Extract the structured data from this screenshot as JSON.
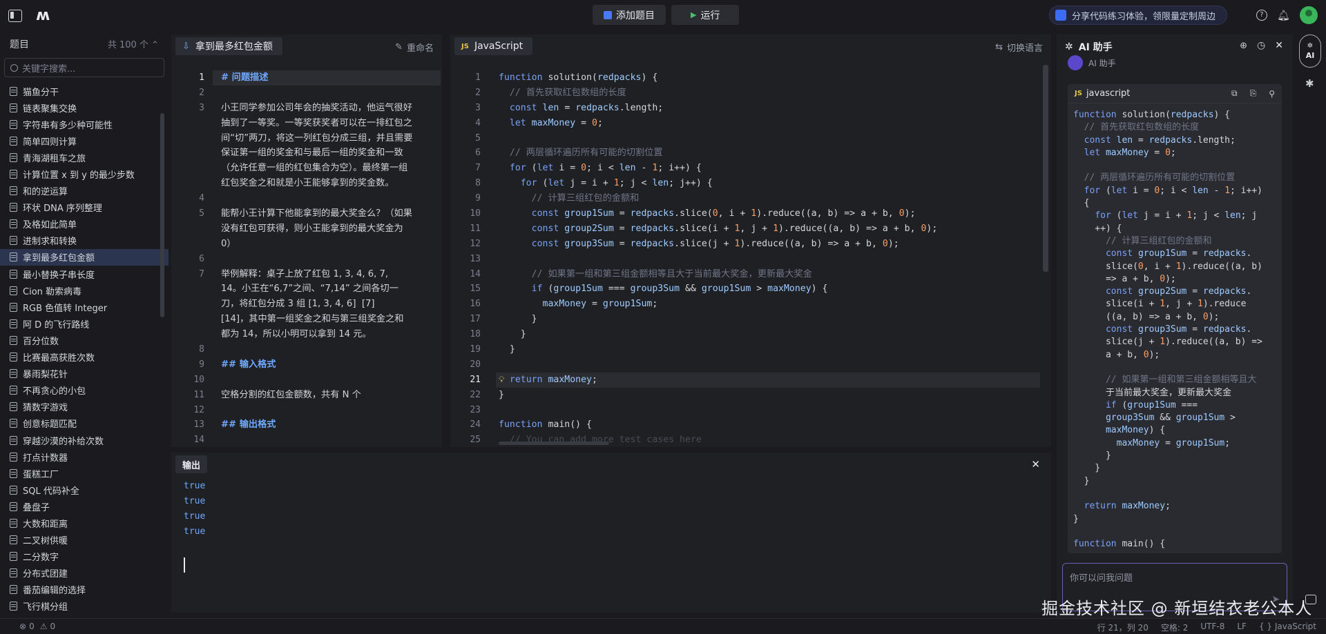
{
  "topbar": {
    "add_problem": "添加题目",
    "run": "运行",
    "promo": "分享代码练习体验，领限量定制周边"
  },
  "problems": {
    "title": "题目",
    "count": "共 100 个",
    "search_placeholder": "关键字搜索...",
    "items": [
      "猫鱼分干",
      "链表聚集交换",
      "字符串有多少种可能性",
      "简单四则计算",
      "青海湖租车之旅",
      "计算位置 x 到 y 的最少步数",
      "和的逆运算",
      "环状 DNA 序列整理",
      "及格如此简单",
      "进制求和转换",
      "拿到最多红包金额",
      "最小替换子串长度",
      "Cion 勒索病毒",
      "RGB 色值转 Integer",
      "阿 D 的飞行路线",
      "百分位数",
      "比赛最高获胜次数",
      "暴雨梨花针",
      "不再贪心的小包",
      "猜数字游戏",
      "创意标题匹配",
      "穿越沙漠的补给次数",
      "打点计数器",
      "蛋糕工厂",
      "SQL 代码补全",
      "叠盘子",
      "大数和距离",
      "二叉树供暖",
      "二分数字",
      "分布式团建",
      "番茄编辑的选择",
      "飞行棋分组"
    ],
    "active_index": 10
  },
  "description": {
    "tab": "拿到最多红包金额",
    "rename": "重命名",
    "line_numbers": [
      "1",
      "2",
      "3",
      "",
      "",
      "",
      "",
      "",
      "4",
      "5",
      "",
      "",
      "6",
      "7",
      "",
      "",
      "",
      "",
      "8",
      "9",
      "10",
      "11",
      "12",
      "13",
      "14"
    ],
    "lines": [
      "# 问题描述",
      "",
      "小王同学参加公司年会的抽奖活动，他运气很好",
      "抽到了一等奖。一等奖获奖者可以在一排红包之",
      "间“切”两刀，将这一列红包分成三组，并且需要",
      "保证第一组的奖金和与最后一组的奖金和一致",
      "（允许任意一组的红包集合为空）。最终第一组",
      "红包奖金之和就是小王能够拿到的奖金数。",
      "",
      "能帮小王计算下他能拿到的最大奖金么？（如果",
      "没有红包可获得，则小王能拿到的最大奖金为",
      "0）",
      "",
      "举例解释：桌子上放了红包 1, 3, 4, 6, 7,",
      "14。小王在“6,7”之间、“7,14” 之间各切一",
      "刀，将红包分成 3 组 [1, 3, 4, 6]  [7]",
      "[14]，其中第一组奖金之和与第三组奖金之和",
      "都为 14，所以小明可以拿到 14 元。",
      "",
      "## 输入格式",
      "",
      "空格分割的红包金额数，共有 N 个",
      "",
      "## 输出格式",
      ""
    ]
  },
  "editor": {
    "tab": "JavaScript",
    "switch_lang": "切换语言",
    "lines": [
      "function solution(redpacks) {",
      "  // 首先获取红包数组的长度",
      "  const len = redpacks.length;",
      "  let maxMoney = 0;",
      "",
      "  // 两层循环遍历所有可能的切割位置",
      "  for (let i = 0; i < len - 1; i++) {",
      "    for (let j = i + 1; j < len; j++) {",
      "      // 计算三组红包的金额和",
      "      const group1Sum = redpacks.slice(0, i + 1).reduce((a, b) => a + b, 0);",
      "      const group2Sum = redpacks.slice(i + 1, j + 1).reduce((a, b) => a + b, 0);",
      "      const group3Sum = redpacks.slice(j + 1).reduce((a, b) => a + b, 0);",
      "",
      "      // 如果第一组和第三组金额相等且大于当前最大奖金，更新最大奖金",
      "      if (group1Sum === group3Sum && group1Sum > maxMoney) {",
      "        maxMoney = group1Sum;",
      "      }",
      "    }",
      "  }",
      "",
      "  return maxMoney;",
      "}",
      "",
      "function main() {",
      "  // You can add more test cases here"
    ]
  },
  "output": {
    "title": "输出",
    "lines": [
      "true",
      "true",
      "true",
      "true"
    ]
  },
  "ai": {
    "title": "AI 助手",
    "sub": "AI 助手",
    "lang": "javascript",
    "lines": [
      "function solution(redpacks) {",
      "  // 首先获取红包数组的长度",
      "  const len = redpacks.length;",
      "  let maxMoney = 0;",
      "",
      "  // 两层循环遍历所有可能的切割位置",
      "  for (let i = 0; i < len - 1; i++)",
      "  {",
      "    for (let j = i + 1; j < len; j",
      "    ++) {",
      "      // 计算三组红包的金额和",
      "      const group1Sum = redpacks.",
      "      slice(0, i + 1).reduce((a, b)",
      "      => a + b, 0);",
      "      const group2Sum = redpacks.",
      "      slice(i + 1, j + 1).reduce",
      "      ((a, b) => a + b, 0);",
      "      const group3Sum = redpacks.",
      "      slice(j + 1).reduce((a, b) =>",
      "      a + b, 0);",
      "",
      "      // 如果第一组和第三组金额相等且大",
      "      于当前最大奖金，更新最大奖金",
      "      if (group1Sum ===",
      "      group3Sum && group1Sum >",
      "      maxMoney) {",
      "        maxMoney = group1Sum;",
      "      }",
      "    }",
      "  }",
      "",
      "  return maxMoney;",
      "}",
      "",
      "function main() {"
    ],
    "input_placeholder": "你可以问我问题"
  },
  "rail": {
    "ai": "AI"
  },
  "status": {
    "problems": "0",
    "warnings": "0",
    "cursor": "行 21，列 20",
    "spaces": "空格: 2",
    "encoding": "UTF-8",
    "eol": "LF",
    "lang": "JavaScript"
  },
  "watermark": "掘金技术社区 @ 新垣结衣老公本人"
}
